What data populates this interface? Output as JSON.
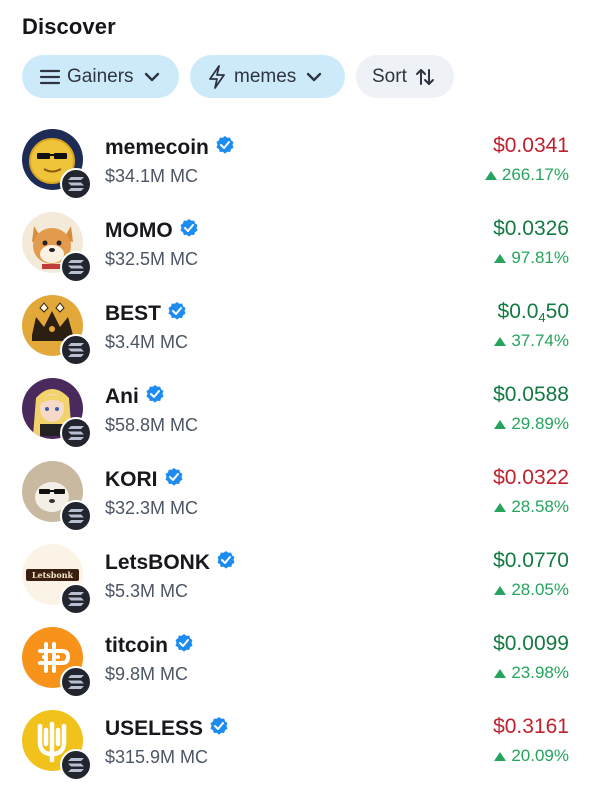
{
  "header": {
    "title": "Discover"
  },
  "filters": {
    "gainers": {
      "label": "Gainers",
      "icon": "menu-icon"
    },
    "category": {
      "label": "memes",
      "icon": "lightning-icon"
    },
    "sort": {
      "label": "Sort",
      "icon": "sort-arrows-icon"
    }
  },
  "colors": {
    "up": "#137a42",
    "down": "#c0212e",
    "change": "#26a45d",
    "verified": "#1d8cf0"
  },
  "tokens": [
    {
      "name": "memecoin",
      "mc": "$34.1M MC",
      "price": "$0.0341",
      "price_dir": "down",
      "change": "266.17%",
      "avatar": "memecoin-avatar"
    },
    {
      "name": "MOMO",
      "mc": "$32.5M MC",
      "price": "$0.0326",
      "price_dir": "up",
      "change": "97.81%",
      "avatar": "momo-avatar"
    },
    {
      "name": "BEST",
      "mc": "$3.4M MC",
      "price_prefix": "$0.0",
      "price_sub": "4",
      "price_suffix": "50",
      "price_dir": "up",
      "change": "37.74%",
      "avatar": "best-avatar"
    },
    {
      "name": "Ani",
      "mc": "$58.8M MC",
      "price": "$0.0588",
      "price_dir": "up",
      "change": "29.89%",
      "avatar": "ani-avatar"
    },
    {
      "name": "KORI",
      "mc": "$32.3M MC",
      "price": "$0.0322",
      "price_dir": "down",
      "change": "28.58%",
      "avatar": "kori-avatar"
    },
    {
      "name": "LetsBONK",
      "mc": "$5.3M MC",
      "price": "$0.0770",
      "price_dir": "up",
      "change": "28.05%",
      "avatar": "letsbonk-avatar",
      "avatar_text": "Letsbonk"
    },
    {
      "name": "titcoin",
      "mc": "$9.8M MC",
      "price": "$0.0099",
      "price_dir": "up",
      "change": "23.98%",
      "avatar": "titcoin-avatar"
    },
    {
      "name": "USELESS",
      "mc": "$315.9M MC",
      "price": "$0.3161",
      "price_dir": "down",
      "change": "20.09%",
      "avatar": "useless-avatar"
    }
  ]
}
